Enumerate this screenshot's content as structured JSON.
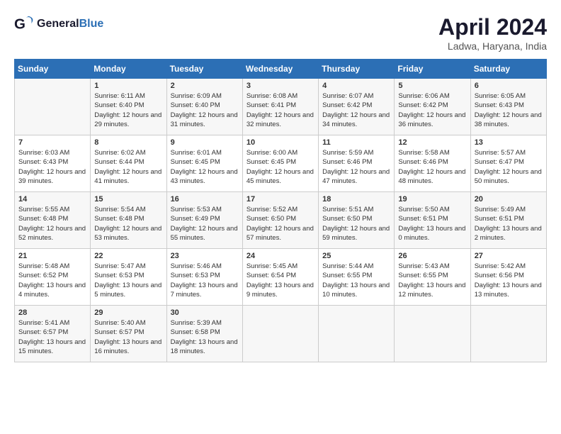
{
  "header": {
    "logo_general": "General",
    "logo_blue": "Blue",
    "month_year": "April 2024",
    "location": "Ladwa, Haryana, India"
  },
  "days_of_week": [
    "Sunday",
    "Monday",
    "Tuesday",
    "Wednesday",
    "Thursday",
    "Friday",
    "Saturday"
  ],
  "weeks": [
    [
      {
        "day": "",
        "sunrise": "",
        "sunset": "",
        "daylight": ""
      },
      {
        "day": "1",
        "sunrise": "Sunrise: 6:11 AM",
        "sunset": "Sunset: 6:40 PM",
        "daylight": "Daylight: 12 hours and 29 minutes."
      },
      {
        "day": "2",
        "sunrise": "Sunrise: 6:09 AM",
        "sunset": "Sunset: 6:40 PM",
        "daylight": "Daylight: 12 hours and 31 minutes."
      },
      {
        "day": "3",
        "sunrise": "Sunrise: 6:08 AM",
        "sunset": "Sunset: 6:41 PM",
        "daylight": "Daylight: 12 hours and 32 minutes."
      },
      {
        "day": "4",
        "sunrise": "Sunrise: 6:07 AM",
        "sunset": "Sunset: 6:42 PM",
        "daylight": "Daylight: 12 hours and 34 minutes."
      },
      {
        "day": "5",
        "sunrise": "Sunrise: 6:06 AM",
        "sunset": "Sunset: 6:42 PM",
        "daylight": "Daylight: 12 hours and 36 minutes."
      },
      {
        "day": "6",
        "sunrise": "Sunrise: 6:05 AM",
        "sunset": "Sunset: 6:43 PM",
        "daylight": "Daylight: 12 hours and 38 minutes."
      }
    ],
    [
      {
        "day": "7",
        "sunrise": "Sunrise: 6:03 AM",
        "sunset": "Sunset: 6:43 PM",
        "daylight": "Daylight: 12 hours and 39 minutes."
      },
      {
        "day": "8",
        "sunrise": "Sunrise: 6:02 AM",
        "sunset": "Sunset: 6:44 PM",
        "daylight": "Daylight: 12 hours and 41 minutes."
      },
      {
        "day": "9",
        "sunrise": "Sunrise: 6:01 AM",
        "sunset": "Sunset: 6:45 PM",
        "daylight": "Daylight: 12 hours and 43 minutes."
      },
      {
        "day": "10",
        "sunrise": "Sunrise: 6:00 AM",
        "sunset": "Sunset: 6:45 PM",
        "daylight": "Daylight: 12 hours and 45 minutes."
      },
      {
        "day": "11",
        "sunrise": "Sunrise: 5:59 AM",
        "sunset": "Sunset: 6:46 PM",
        "daylight": "Daylight: 12 hours and 47 minutes."
      },
      {
        "day": "12",
        "sunrise": "Sunrise: 5:58 AM",
        "sunset": "Sunset: 6:46 PM",
        "daylight": "Daylight: 12 hours and 48 minutes."
      },
      {
        "day": "13",
        "sunrise": "Sunrise: 5:57 AM",
        "sunset": "Sunset: 6:47 PM",
        "daylight": "Daylight: 12 hours and 50 minutes."
      }
    ],
    [
      {
        "day": "14",
        "sunrise": "Sunrise: 5:55 AM",
        "sunset": "Sunset: 6:48 PM",
        "daylight": "Daylight: 12 hours and 52 minutes."
      },
      {
        "day": "15",
        "sunrise": "Sunrise: 5:54 AM",
        "sunset": "Sunset: 6:48 PM",
        "daylight": "Daylight: 12 hours and 53 minutes."
      },
      {
        "day": "16",
        "sunrise": "Sunrise: 5:53 AM",
        "sunset": "Sunset: 6:49 PM",
        "daylight": "Daylight: 12 hours and 55 minutes."
      },
      {
        "day": "17",
        "sunrise": "Sunrise: 5:52 AM",
        "sunset": "Sunset: 6:50 PM",
        "daylight": "Daylight: 12 hours and 57 minutes."
      },
      {
        "day": "18",
        "sunrise": "Sunrise: 5:51 AM",
        "sunset": "Sunset: 6:50 PM",
        "daylight": "Daylight: 12 hours and 59 minutes."
      },
      {
        "day": "19",
        "sunrise": "Sunrise: 5:50 AM",
        "sunset": "Sunset: 6:51 PM",
        "daylight": "Daylight: 13 hours and 0 minutes."
      },
      {
        "day": "20",
        "sunrise": "Sunrise: 5:49 AM",
        "sunset": "Sunset: 6:51 PM",
        "daylight": "Daylight: 13 hours and 2 minutes."
      }
    ],
    [
      {
        "day": "21",
        "sunrise": "Sunrise: 5:48 AM",
        "sunset": "Sunset: 6:52 PM",
        "daylight": "Daylight: 13 hours and 4 minutes."
      },
      {
        "day": "22",
        "sunrise": "Sunrise: 5:47 AM",
        "sunset": "Sunset: 6:53 PM",
        "daylight": "Daylight: 13 hours and 5 minutes."
      },
      {
        "day": "23",
        "sunrise": "Sunrise: 5:46 AM",
        "sunset": "Sunset: 6:53 PM",
        "daylight": "Daylight: 13 hours and 7 minutes."
      },
      {
        "day": "24",
        "sunrise": "Sunrise: 5:45 AM",
        "sunset": "Sunset: 6:54 PM",
        "daylight": "Daylight: 13 hours and 9 minutes."
      },
      {
        "day": "25",
        "sunrise": "Sunrise: 5:44 AM",
        "sunset": "Sunset: 6:55 PM",
        "daylight": "Daylight: 13 hours and 10 minutes."
      },
      {
        "day": "26",
        "sunrise": "Sunrise: 5:43 AM",
        "sunset": "Sunset: 6:55 PM",
        "daylight": "Daylight: 13 hours and 12 minutes."
      },
      {
        "day": "27",
        "sunrise": "Sunrise: 5:42 AM",
        "sunset": "Sunset: 6:56 PM",
        "daylight": "Daylight: 13 hours and 13 minutes."
      }
    ],
    [
      {
        "day": "28",
        "sunrise": "Sunrise: 5:41 AM",
        "sunset": "Sunset: 6:57 PM",
        "daylight": "Daylight: 13 hours and 15 minutes."
      },
      {
        "day": "29",
        "sunrise": "Sunrise: 5:40 AM",
        "sunset": "Sunset: 6:57 PM",
        "daylight": "Daylight: 13 hours and 16 minutes."
      },
      {
        "day": "30",
        "sunrise": "Sunrise: 5:39 AM",
        "sunset": "Sunset: 6:58 PM",
        "daylight": "Daylight: 13 hours and 18 minutes."
      },
      {
        "day": "",
        "sunrise": "",
        "sunset": "",
        "daylight": ""
      },
      {
        "day": "",
        "sunrise": "",
        "sunset": "",
        "daylight": ""
      },
      {
        "day": "",
        "sunrise": "",
        "sunset": "",
        "daylight": ""
      },
      {
        "day": "",
        "sunrise": "",
        "sunset": "",
        "daylight": ""
      }
    ]
  ]
}
